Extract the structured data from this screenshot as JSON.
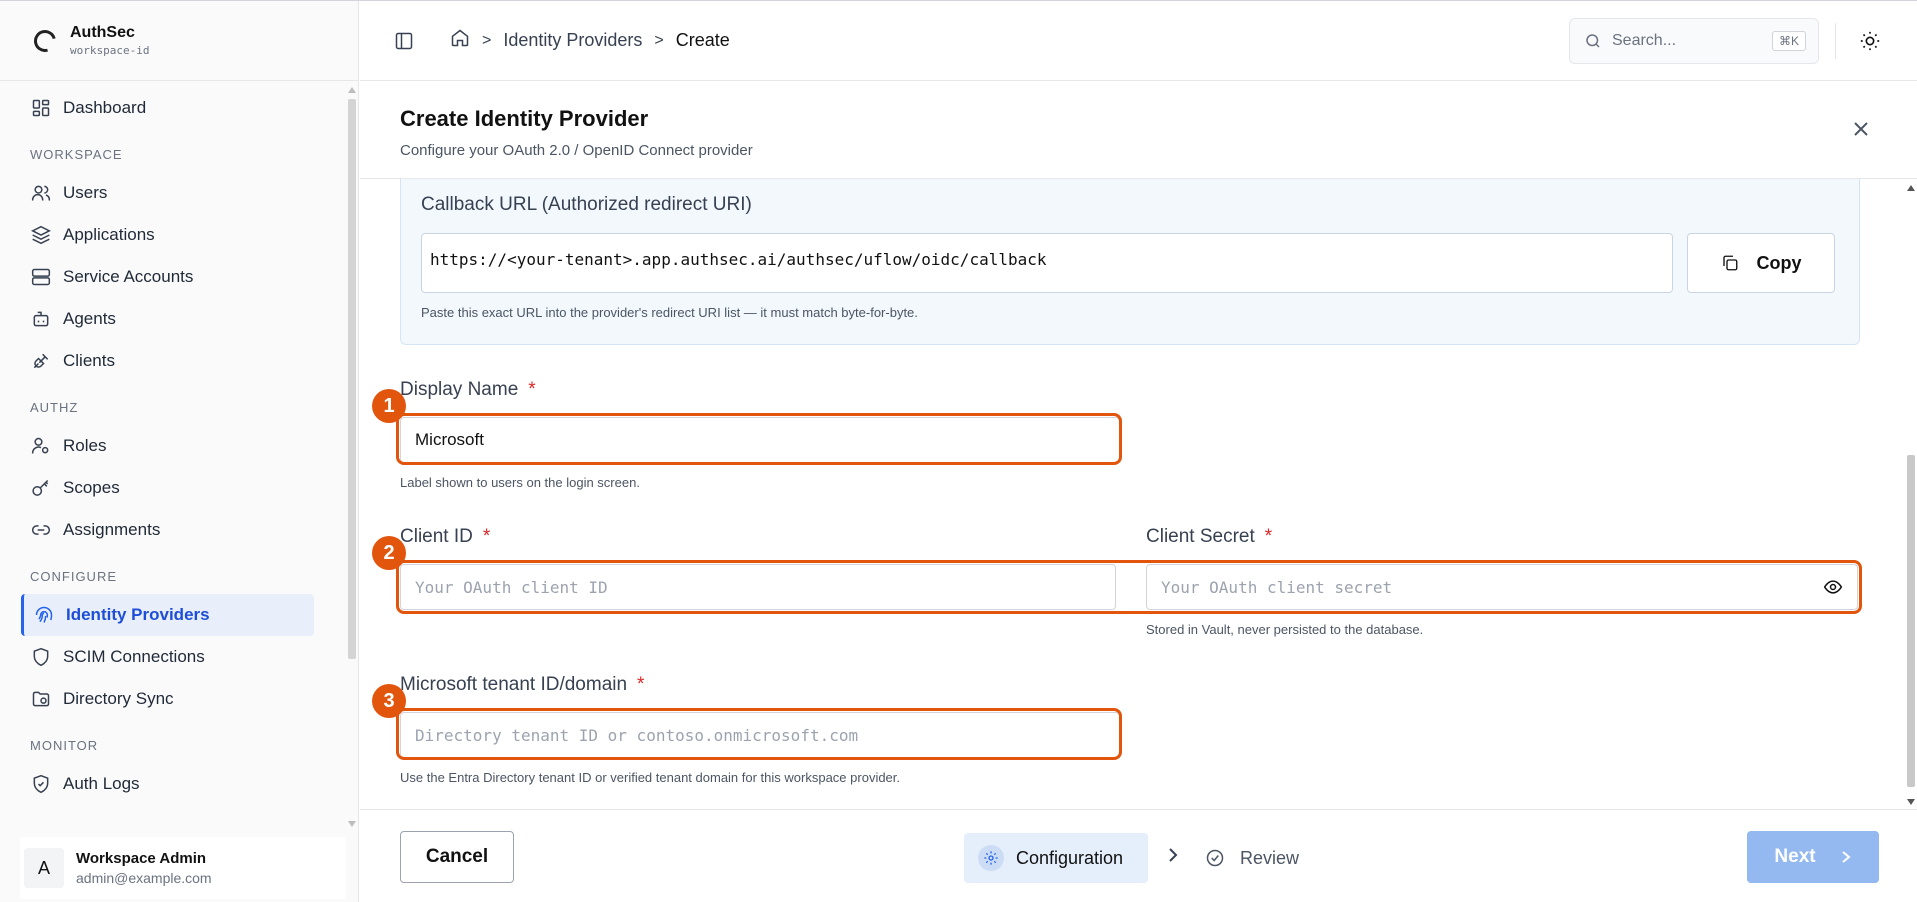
{
  "brand": {
    "name": "AuthSec",
    "workspace": "workspace-id"
  },
  "sidebar": {
    "dashboard": "Dashboard",
    "sections": {
      "workspace": "WORKSPACE",
      "authz": "AUTHZ",
      "configure": "CONFIGURE",
      "monitor": "MONITOR"
    },
    "items": {
      "users": "Users",
      "applications": "Applications",
      "service_accounts": "Service Accounts",
      "agents": "Agents",
      "clients": "Clients",
      "roles": "Roles",
      "scopes": "Scopes",
      "assignments": "Assignments",
      "identity_providers": "Identity Providers",
      "scim_connections": "SCIM Connections",
      "directory_sync": "Directory Sync",
      "auth_logs": "Auth Logs"
    },
    "active_item": "identity_providers",
    "user": {
      "initial": "A",
      "name": "Workspace Admin",
      "email": "admin@example.com"
    }
  },
  "topbar": {
    "breadcrumb": [
      "Identity Providers",
      "Create"
    ],
    "search_placeholder": "Search...",
    "search_shortcut": "⌘K"
  },
  "panel": {
    "title": "Create Identity Provider",
    "subtitle": "Configure your OAuth 2.0 / OpenID Connect provider"
  },
  "form": {
    "callback": {
      "label": "Callback URL (Authorized redirect URI)",
      "url": "https://<your-tenant>.app.authsec.ai/authsec/uflow/oidc/callback",
      "copy_label": "Copy",
      "help": "Paste this exact URL into the provider's redirect URI list — it must match byte-for-byte."
    },
    "display_name": {
      "label": "Display Name",
      "required_mark": "*",
      "value": "Microsoft",
      "help": "Label shown to users on the login screen."
    },
    "client_id": {
      "label": "Client ID",
      "required_mark": "*",
      "placeholder": "Your OAuth client ID"
    },
    "client_secret": {
      "label": "Client Secret",
      "required_mark": "*",
      "placeholder": "Your OAuth client secret",
      "help": "Stored in Vault, never persisted to the database."
    },
    "tenant": {
      "label": "Microsoft tenant ID/domain",
      "required_mark": "*",
      "placeholder": "Directory tenant ID or contoso.onmicrosoft.com",
      "help": "Use the Entra Directory tenant ID or verified tenant domain for this workspace provider."
    }
  },
  "annotations": [
    "1",
    "2",
    "3"
  ],
  "footer": {
    "cancel_label": "Cancel",
    "steps": [
      "Configuration",
      "Review"
    ],
    "active_step": "Configuration",
    "next_label": "Next"
  },
  "colors": {
    "accent": "#2563eb",
    "highlight": "#e2550d",
    "next_disabled": "#93b9f0",
    "required": "#dc2626"
  }
}
